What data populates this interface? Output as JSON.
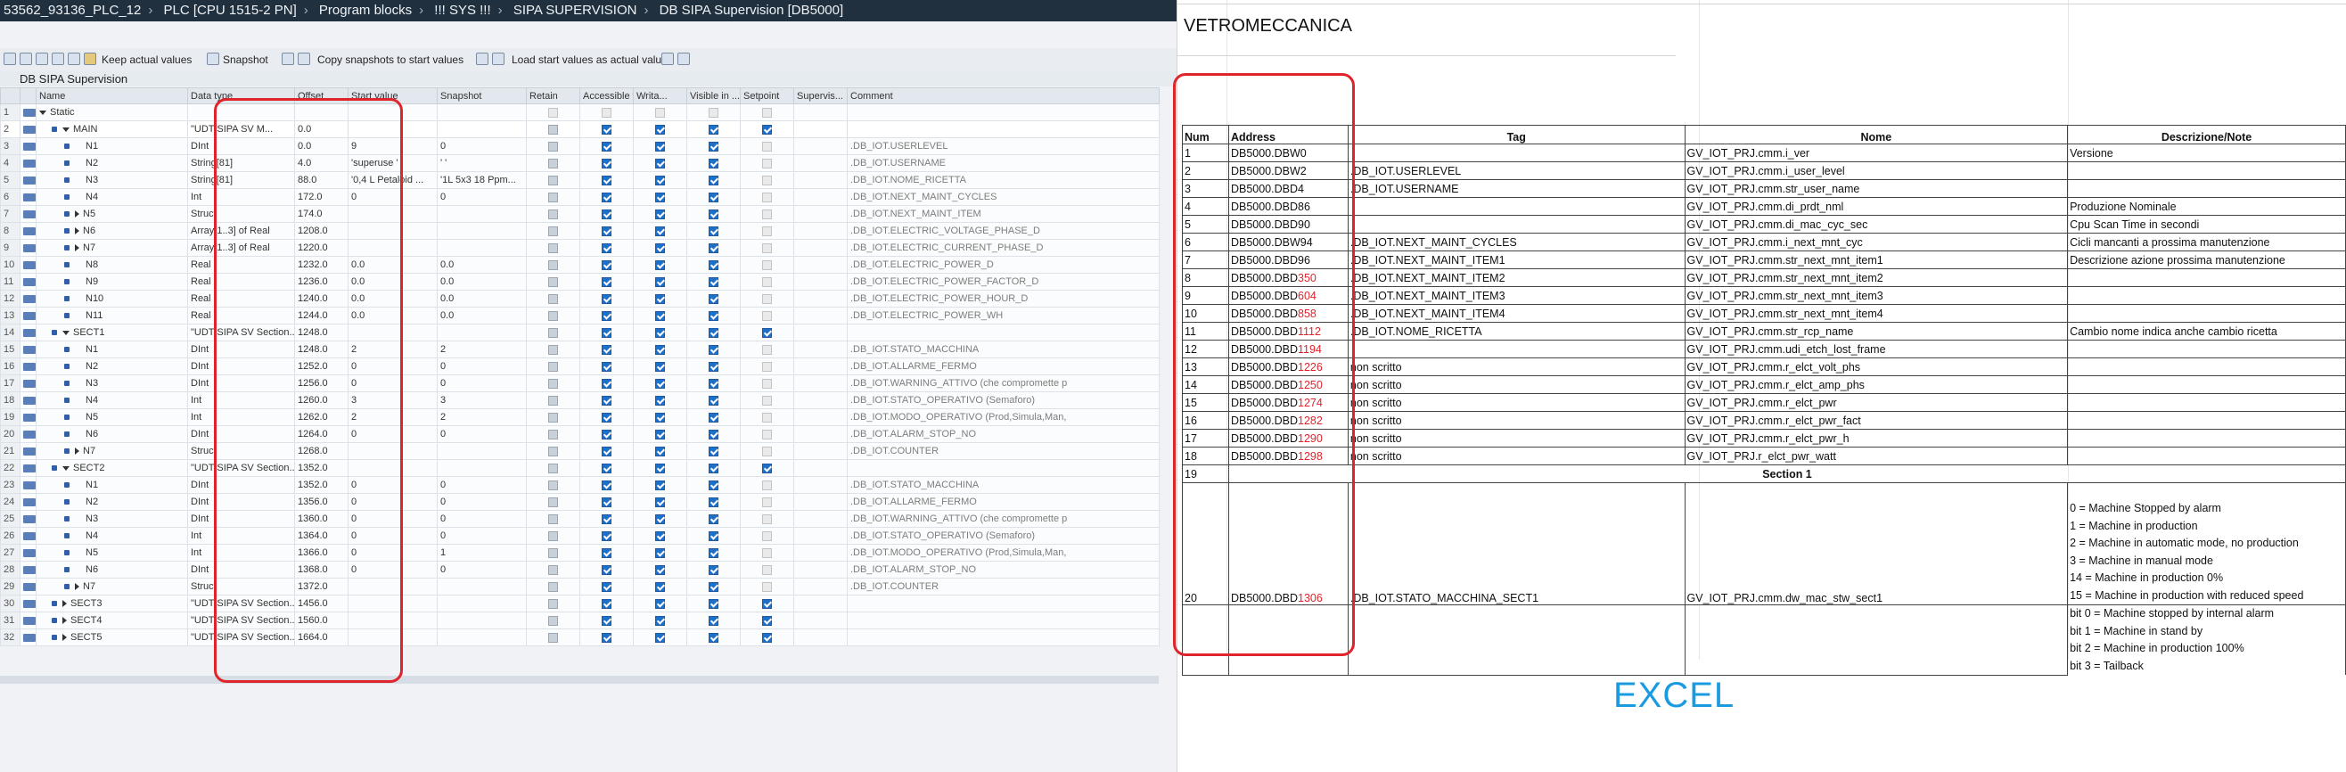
{
  "breadcrumb": [
    "53562_93136_PLC_12",
    "PLC [CPU 1515-2 PN]",
    "Program blocks",
    "!!! SYS !!!",
    "SIPA SUPERVISION",
    "DB SIPA Supervision [DB5000]"
  ],
  "toolbar": {
    "keep_actual": "Keep actual values",
    "snapshot": "Snapshot",
    "copy_snapshots": "Copy snapshots to start values",
    "load_start": "Load start values as actual values"
  },
  "db_title": "DB SIPA Supervision",
  "columns": [
    "Name",
    "Data type",
    "Offset",
    "Start value",
    "Snapshot",
    "Retain",
    "Accessible f...",
    "Writa...",
    "Visible in ...",
    "Setpoint",
    "Supervis...",
    "Comment"
  ],
  "rows": [
    {
      "n": "1",
      "name": "Static",
      "type": "",
      "offset": "",
      "start": "",
      "snap": "",
      "cmt": ""
    },
    {
      "n": "2",
      "name": "MAIN",
      "type": "\"UDT SIPA SV M...",
      "offset": "0.0",
      "start": "",
      "snap": "",
      "cmt": ""
    },
    {
      "n": "3",
      "name": "N1",
      "type": "DInt",
      "offset": "0.0",
      "start": "9",
      "snap": "0",
      "cmt": ".DB_IOT.USERLEVEL"
    },
    {
      "n": "4",
      "name": "N2",
      "type": "String[81]",
      "offset": "4.0",
      "start": "'superuse '",
      "snap": "'        '",
      "cmt": ".DB_IOT.USERNAME"
    },
    {
      "n": "5",
      "name": "N3",
      "type": "String[81]",
      "offset": "88.0",
      "start": "'0,4 L Petaloid ...",
      "snap": "'1L 5x3 18 Ppm...",
      "cmt": ".DB_IOT.NOME_RICETTA"
    },
    {
      "n": "6",
      "name": "N4",
      "type": "Int",
      "offset": "172.0",
      "start": "0",
      "snap": "0",
      "cmt": ".DB_IOT.NEXT_MAINT_CYCLES"
    },
    {
      "n": "7",
      "name": "N5",
      "type": "Struct",
      "offset": "174.0",
      "start": "",
      "snap": "",
      "cmt": ".DB_IOT.NEXT_MAINT_ITEM"
    },
    {
      "n": "8",
      "name": "N6",
      "type": "Array[1..3] of Real",
      "offset": "1208.0",
      "start": "",
      "snap": "",
      "cmt": ".DB_IOT.ELECTRIC_VOLTAGE_PHASE_D"
    },
    {
      "n": "9",
      "name": "N7",
      "type": "Array[1..3] of Real",
      "offset": "1220.0",
      "start": "",
      "snap": "",
      "cmt": ".DB_IOT.ELECTRIC_CURRENT_PHASE_D"
    },
    {
      "n": "10",
      "name": "N8",
      "type": "Real",
      "offset": "1232.0",
      "start": "0.0",
      "snap": "0.0",
      "cmt": ".DB_IOT.ELECTRIC_POWER_D"
    },
    {
      "n": "11",
      "name": "N9",
      "type": "Real",
      "offset": "1236.0",
      "start": "0.0",
      "snap": "0.0",
      "cmt": ".DB_IOT.ELECTRIC_POWER_FACTOR_D"
    },
    {
      "n": "12",
      "name": "N10",
      "type": "Real",
      "offset": "1240.0",
      "start": "0.0",
      "snap": "0.0",
      "cmt": ".DB_IOT.ELECTRIC_POWER_HOUR_D"
    },
    {
      "n": "13",
      "name": "N11",
      "type": "Real",
      "offset": "1244.0",
      "start": "0.0",
      "snap": "0.0",
      "cmt": ".DB_IOT.ELECTRIC_POWER_WH"
    },
    {
      "n": "14",
      "name": "SECT1",
      "type": "\"UDT SIPA SV Section...",
      "offset": "1248.0",
      "start": "",
      "snap": "",
      "cmt": ""
    },
    {
      "n": "15",
      "name": "N1",
      "type": "DInt",
      "offset": "1248.0",
      "start": "2",
      "snap": "2",
      "cmt": ".DB_IOT.STATO_MACCHINA"
    },
    {
      "n": "16",
      "name": "N2",
      "type": "DInt",
      "offset": "1252.0",
      "start": "0",
      "snap": "0",
      "cmt": ".DB_IOT.ALLARME_FERMO"
    },
    {
      "n": "17",
      "name": "N3",
      "type": "DInt",
      "offset": "1256.0",
      "start": "0",
      "snap": "0",
      "cmt": ".DB_IOT.WARNING_ATTIVO  (che compromette p"
    },
    {
      "n": "18",
      "name": "N4",
      "type": "Int",
      "offset": "1260.0",
      "start": "3",
      "snap": "3",
      "cmt": ".DB_IOT.STATO_OPERATIVO  (Semaforo)"
    },
    {
      "n": "19",
      "name": "N5",
      "type": "Int",
      "offset": "1262.0",
      "start": "2",
      "snap": "2",
      "cmt": ".DB_IOT.MODO_OPERATIVO  (Prod,Simula,Man,"
    },
    {
      "n": "20",
      "name": "N6",
      "type": "DInt",
      "offset": "1264.0",
      "start": "0",
      "snap": "0",
      "cmt": ".DB_IOT.ALARM_STOP_NO"
    },
    {
      "n": "21",
      "name": "N7",
      "type": "Struct",
      "offset": "1268.0",
      "start": "",
      "snap": "",
      "cmt": ".DB_IOT.COUNTER"
    },
    {
      "n": "22",
      "name": "SECT2",
      "type": "\"UDT SIPA SV Section...",
      "offset": "1352.0",
      "start": "",
      "snap": "",
      "cmt": ""
    },
    {
      "n": "23",
      "name": "N1",
      "type": "DInt",
      "offset": "1352.0",
      "start": "0",
      "snap": "0",
      "cmt": ".DB_IOT.STATO_MACCHINA"
    },
    {
      "n": "24",
      "name": "N2",
      "type": "DInt",
      "offset": "1356.0",
      "start": "0",
      "snap": "0",
      "cmt": ".DB_IOT.ALLARME_FERMO"
    },
    {
      "n": "25",
      "name": "N3",
      "type": "DInt",
      "offset": "1360.0",
      "start": "0",
      "snap": "0",
      "cmt": ".DB_IOT.WARNING_ATTIVO  (che compromette p"
    },
    {
      "n": "26",
      "name": "N4",
      "type": "Int",
      "offset": "1364.0",
      "start": "0",
      "snap": "0",
      "cmt": ".DB_IOT.STATO_OPERATIVO  (Semaforo)"
    },
    {
      "n": "27",
      "name": "N5",
      "type": "Int",
      "offset": "1366.0",
      "start": "0",
      "snap": "1",
      "cmt": ".DB_IOT.MODO_OPERATIVO  (Prod,Simula,Man,"
    },
    {
      "n": "28",
      "name": "N6",
      "type": "DInt",
      "offset": "1368.0",
      "start": "0",
      "snap": "0",
      "cmt": ".DB_IOT.ALARM_STOP_NO"
    },
    {
      "n": "29",
      "name": "N7",
      "type": "Struct",
      "offset": "1372.0",
      "start": "",
      "snap": "",
      "cmt": ".DB_IOT.COUNTER"
    },
    {
      "n": "30",
      "name": "SECT3",
      "type": "\"UDT SIPA SV Section...",
      "offset": "1456.0",
      "start": "",
      "snap": "",
      "cmt": ""
    },
    {
      "n": "31",
      "name": "SECT4",
      "type": "\"UDT SIPA SV Section...",
      "offset": "1560.0",
      "start": "",
      "snap": "",
      "cmt": ""
    },
    {
      "n": "32",
      "name": "SECT5",
      "type": "\"UDT SIPA SV Section...",
      "offset": "1664.0",
      "start": "",
      "snap": "",
      "cmt": ""
    }
  ],
  "excel": {
    "title": "VETROMECCANICA",
    "headers": [
      "Num",
      "Address",
      "Tag",
      "Nome",
      "Descrizione/Note"
    ],
    "rows": [
      {
        "num": "1",
        "addr": "DB5000.DBW0",
        "addr_red": "",
        "tag": "",
        "nome": "GV_IOT_PRJ.cmm.i_ver",
        "note": "Versione",
        "note_red": true
      },
      {
        "num": "2",
        "addr": "DB5000.DBW2",
        "addr_red": "",
        "tag": ".DB_IOT.USERLEVEL",
        "nome": "GV_IOT_PRJ.cmm.i_user_level",
        "note": "",
        "note_red": false
      },
      {
        "num": "3",
        "addr": "DB5000.DBD4",
        "addr_red": "",
        "tag": ".DB_IOT.USERNAME",
        "nome": "GV_IOT_PRJ.cmm.str_user_name",
        "note": "",
        "note_red": false
      },
      {
        "num": "4",
        "addr": "DB5000.DBD86",
        "addr_red": "",
        "tag": "",
        "nome": "GV_IOT_PRJ.cmm.di_prdt_nml",
        "note": "Produzione Nominale",
        "note_red": true
      },
      {
        "num": "5",
        "addr": "DB5000.DBD90",
        "addr_red": "",
        "tag": "",
        "nome": "GV_IOT_PRJ.cmm.di_mac_cyc_sec",
        "note": "Cpu Scan Time in secondi",
        "note_red": true
      },
      {
        "num": "6",
        "addr": "DB5000.DBW94",
        "addr_red": "",
        "tag": ".DB_IOT.NEXT_MAINT_CYCLES",
        "nome": "GV_IOT_PRJ.cmm.i_next_mnt_cyc",
        "note": "Cicli mancanti a prossima manutenzione",
        "note_red": false
      },
      {
        "num": "7",
        "addr": "DB5000.DBD96",
        "addr_red": "",
        "tag": ".DB_IOT.NEXT_MAINT_ITEM1",
        "nome": "GV_IOT_PRJ.cmm.str_next_mnt_item1",
        "note": "Descrizione azione prossima manutenzione",
        "note_red": false
      },
      {
        "num": "8",
        "addr": "DB5000.DBD",
        "addr_red": "350",
        "tag": ".DB_IOT.NEXT_MAINT_ITEM2",
        "nome": "GV_IOT_PRJ.cmm.str_next_mnt_item2",
        "note": "",
        "note_red": false
      },
      {
        "num": "9",
        "addr": "DB5000.DBD",
        "addr_red": "604",
        "tag": ".DB_IOT.NEXT_MAINT_ITEM3",
        "nome": "GV_IOT_PRJ.cmm.str_next_mnt_item3",
        "note": "",
        "note_red": false
      },
      {
        "num": "10",
        "addr": "DB5000.DBD",
        "addr_red": "858",
        "tag": ".DB_IOT.NEXT_MAINT_ITEM4",
        "nome": "GV_IOT_PRJ.cmm.str_next_mnt_item4",
        "note": "",
        "note_red": false
      },
      {
        "num": "11",
        "addr": "DB5000.DBD",
        "addr_red": "1112",
        "tag": ".DB_IOT.NOME_RICETTA",
        "nome": "GV_IOT_PRJ.cmm.str_rcp_name",
        "note": "Cambio nome indica anche cambio ricetta",
        "note_red": false
      },
      {
        "num": "12",
        "addr": "DB5000.DBD",
        "addr_red": "1194",
        "tag": "",
        "nome": "GV_IOT_PRJ.cmm.udi_etch_lost_frame",
        "note": "",
        "note_red": false
      },
      {
        "num": "13",
        "addr": "DB5000.DBD",
        "addr_red": "1226",
        "tag": "non scritto",
        "nome": "GV_IOT_PRJ.cmm.r_elct_volt_phs",
        "note": "",
        "note_red": false
      },
      {
        "num": "14",
        "addr": "DB5000.DBD",
        "addr_red": "1250",
        "tag": "non scritto",
        "nome": "GV_IOT_PRJ.cmm.r_elct_amp_phs",
        "note": "",
        "note_red": false
      },
      {
        "num": "15",
        "addr": "DB5000.DBD",
        "addr_red": "1274",
        "tag": "non scritto",
        "nome": "GV_IOT_PRJ.cmm.r_elct_pwr",
        "note": "",
        "note_red": false
      },
      {
        "num": "16",
        "addr": "DB5000.DBD",
        "addr_red": "1282",
        "tag": "non scritto",
        "nome": "GV_IOT_PRJ.cmm.r_elct_pwr_fact",
        "note": "",
        "note_red": false
      },
      {
        "num": "17",
        "addr": "DB5000.DBD",
        "addr_red": "1290",
        "tag": "non scritto",
        "nome": "GV_IOT_PRJ.cmm.r_elct_pwr_h",
        "note": "",
        "note_red": false
      },
      {
        "num": "18",
        "addr": "DB5000.DBD",
        "addr_red": "1298",
        "tag": "non scritto",
        "nome": "GV_IOT_PRJ.r_elct_pwr_watt",
        "note": "",
        "note_red": false
      }
    ],
    "section_row": {
      "num": "19",
      "label": "Section 1"
    },
    "row20": {
      "num": "20",
      "addr": "DB5000.DBD",
      "addr_red": "1306",
      "tag": ".DB_IOT.STATO_MACCHINA_SECT1",
      "nome": "GV_IOT_PRJ.cmm.dw_mac_stw_sect1"
    },
    "row20_notes": [
      "0  = Machine Stopped by alarm",
      "1 = Machine in production",
      "2 = Machine in automatic mode, no production",
      "3 = Machine in manual mode",
      "14 = Machine in production 0%",
      "15 = Machine in production with reduced speed"
    ],
    "row21_notes": [
      "bit 0 = Machine stopped by internal alarm",
      "bit 1 = Machine in stand by",
      "bit 2 = Machine in production 100%",
      "bit 3 = Tailback"
    ],
    "label": "EXCEL"
  },
  "colors": {
    "highlight": "#e0242c",
    "excel_label": "#1a9be0",
    "title_bar": "#20303f",
    "checkbox_on": "#1e6fc7"
  }
}
